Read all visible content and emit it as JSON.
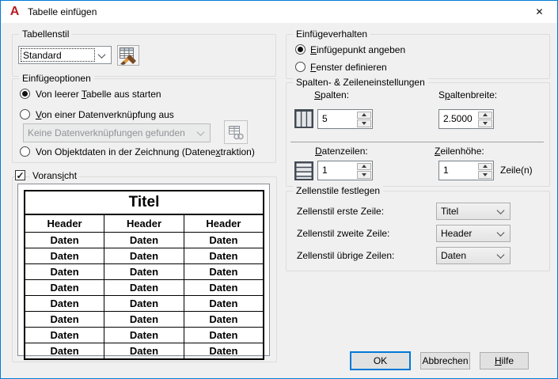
{
  "window": {
    "title": "Tabelle einfügen",
    "close_glyph": "✕",
    "logo_letter": "A"
  },
  "colors": {
    "accent": "#0078d7",
    "logo_red": "#b91c22"
  },
  "table_style": {
    "group_label": "Tabellenstil",
    "style_value": "Standard"
  },
  "insert_options": {
    "group_label": "Einfügeoptionen",
    "from_empty": {
      "pre": "Von leerer ",
      "key": "T",
      "post": "abelle aus starten"
    },
    "from_datalink": {
      "pre": "",
      "key": "V",
      "post": "on einer Datenverknüpfung aus"
    },
    "datalink_value": "Keine Datenverknüpfungen gefunden",
    "from_objectdata": {
      "pre": "Von Objektdaten in der Zeichnung (Datene",
      "key": "x",
      "post": "traktion)"
    }
  },
  "preview": {
    "checkbox_label": {
      "pre": "Vorans",
      "key": "i",
      "post": "cht"
    },
    "check_glyph": "✓",
    "table": {
      "title": "Titel",
      "header": [
        "Header",
        "Header",
        "Header"
      ],
      "rows": [
        [
          "Daten",
          "Daten",
          "Daten"
        ],
        [
          "Daten",
          "Daten",
          "Daten"
        ],
        [
          "Daten",
          "Daten",
          "Daten"
        ],
        [
          "Daten",
          "Daten",
          "Daten"
        ],
        [
          "Daten",
          "Daten",
          "Daten"
        ],
        [
          "Daten",
          "Daten",
          "Daten"
        ],
        [
          "Daten",
          "Daten",
          "Daten"
        ],
        [
          "Daten",
          "Daten",
          "Daten"
        ]
      ]
    }
  },
  "insert_behavior": {
    "group_label": "Einfügeverhalten",
    "point": {
      "pre": "",
      "key": "E",
      "post": "infügepunkt angeben"
    },
    "window_def": {
      "pre": "",
      "key": "F",
      "post": "enster definieren"
    }
  },
  "col_row": {
    "group_label": "Spalten- & Zeileneinstellungen",
    "columns_label": {
      "pre": "",
      "key": "S",
      "post": "palten:"
    },
    "columns_value": "5",
    "col_width_label": {
      "pre": "S",
      "key": "p",
      "post": "altenbreite:"
    },
    "col_width_value": "2.5000",
    "data_rows_label": {
      "pre": "",
      "key": "D",
      "post": "atenzeilen:"
    },
    "data_rows_value": "1",
    "row_height_label": {
      "pre": "",
      "key": "Z",
      "post": "eilenhöhe:"
    },
    "row_height_value": "1",
    "row_height_unit": "Zeile(n)"
  },
  "cell_styles": {
    "group_label": "Zellenstile festlegen",
    "first_label": "Zellenstil erste Zeile:",
    "first_value": "Titel",
    "second_label": "Zellenstil zweite Zeile:",
    "second_value": "Header",
    "other_label": "Zellenstil übrige Zeilen:",
    "other_value": "Daten"
  },
  "buttons": {
    "ok": "OK",
    "cancel": "Abbrechen",
    "help": {
      "pre": "",
      "key": "H",
      "post": "ilfe"
    }
  }
}
